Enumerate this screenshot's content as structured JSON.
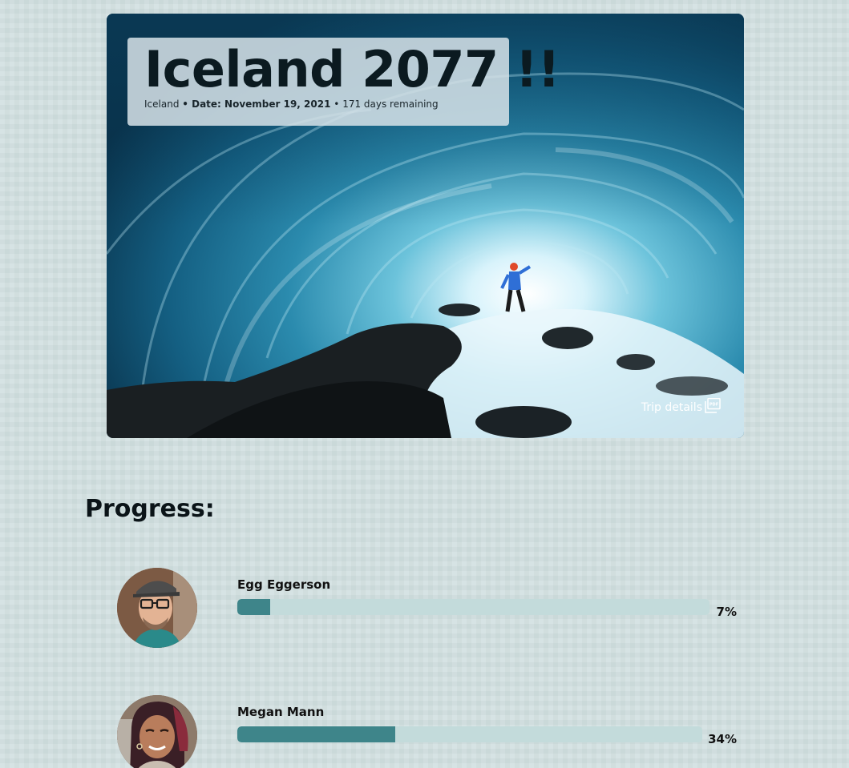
{
  "hero": {
    "title": "Iceland 2077 !!",
    "location": "Iceland",
    "date_label": "Date: November 19, 2021",
    "days_remaining": "171 days remaining",
    "trip_details_label": "Trip details",
    "pdf_icon": "pdf-icon"
  },
  "progress": {
    "heading": "Progress:",
    "members": [
      {
        "name": "Egg Eggerson",
        "percent_label": "7%",
        "percent": 7
      },
      {
        "name": "Megan Mann",
        "percent_label": "34%",
        "percent": 34
      }
    ]
  },
  "colors": {
    "page_background": "#d0dfe0",
    "bar_track": "#c3dbdb",
    "bar_fill": "#3e858a"
  }
}
